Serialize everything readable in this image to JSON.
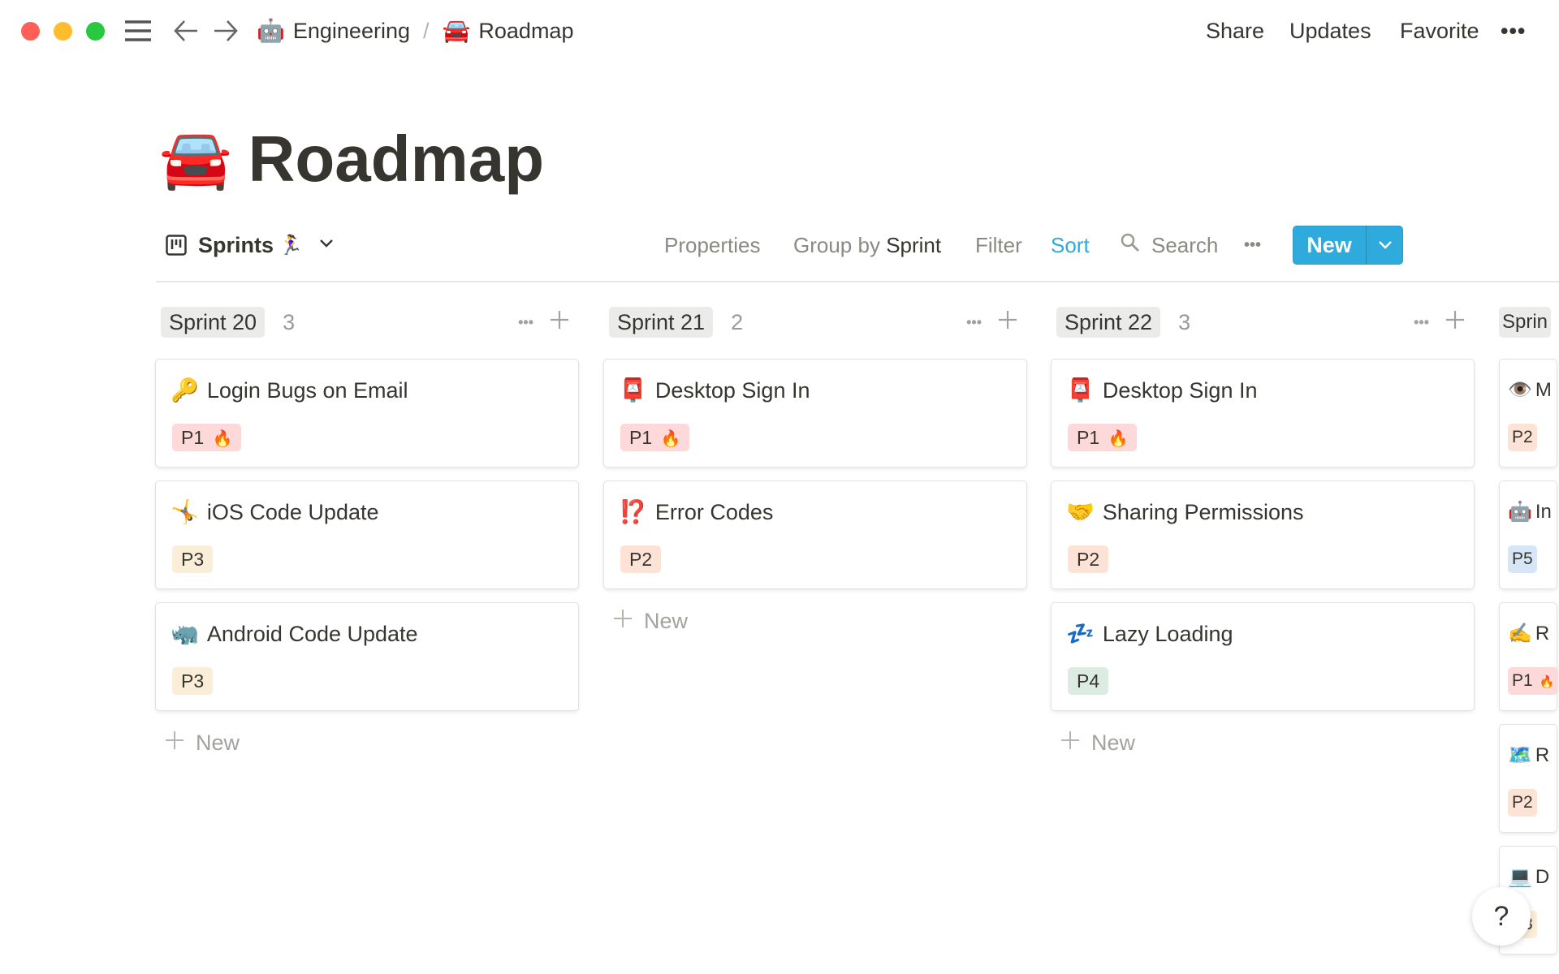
{
  "window": {
    "traffic_lights": {
      "close": "#ff5f57",
      "minimize": "#febc2e",
      "zoom": "#28c840"
    }
  },
  "topbar": {
    "breadcrumb": [
      {
        "icon": "🤖",
        "label": "Engineering"
      },
      {
        "icon": "🚘",
        "label": "Roadmap"
      }
    ],
    "separator": "/",
    "actions": {
      "share": "Share",
      "updates": "Updates",
      "favorite": "Favorite",
      "more": "•••"
    }
  },
  "page": {
    "icon": "🚘",
    "title": "Roadmap"
  },
  "toolbar": {
    "view_name": "Sprints",
    "view_emoji": "🏃‍♀️",
    "properties": "Properties",
    "group_by_prefix": "Group by",
    "group_by_value": "Sprint",
    "filter": "Filter",
    "sort": "Sort",
    "search": "Search",
    "more": "•••",
    "new_label": "New",
    "accent": "#2eaadc"
  },
  "priority_colors": {
    "P1": "#fdd9d9",
    "P2": "#fde2d6",
    "P3": "#fbeed8",
    "P4": "#dcece3",
    "P5": "#d7e6f6"
  },
  "board": {
    "add_new_label": "New",
    "columns": [
      {
        "name": "Sprint 20",
        "count": "3",
        "cards": [
          {
            "emoji": "🔑",
            "title": "Login Bugs on Email",
            "priority": "P1",
            "flag": "🔥"
          },
          {
            "emoji": "🤸",
            "title": "iOS Code Update",
            "priority": "P3",
            "flag": ""
          },
          {
            "emoji": "🦏",
            "title": "Android Code Update",
            "priority": "P3",
            "flag": ""
          }
        ]
      },
      {
        "name": "Sprint 21",
        "count": "2",
        "cards": [
          {
            "emoji": "📮",
            "title": "Desktop Sign In",
            "priority": "P1",
            "flag": "🔥"
          },
          {
            "emoji": "⁉️",
            "title": "Error Codes",
            "priority": "P2",
            "flag": ""
          }
        ]
      },
      {
        "name": "Sprint 22",
        "count": "3",
        "cards": [
          {
            "emoji": "📮",
            "title": "Desktop Sign In",
            "priority": "P1",
            "flag": "🔥"
          },
          {
            "emoji": "🤝",
            "title": "Sharing Permissions",
            "priority": "P2",
            "flag": ""
          },
          {
            "emoji": "💤",
            "title": "Lazy Loading",
            "priority": "P4",
            "flag": ""
          }
        ]
      },
      {
        "name": "Sprin",
        "count": "",
        "cards": [
          {
            "emoji": "👁️",
            "title": "M",
            "priority": "P2",
            "flag": ""
          },
          {
            "emoji": "🤖",
            "title": "In",
            "priority": "P5",
            "flag": ""
          },
          {
            "emoji": "✍️",
            "title": "R",
            "priority": "P1",
            "flag": "🔥"
          },
          {
            "emoji": "🗺️",
            "title": "R",
            "priority": "P2",
            "flag": ""
          },
          {
            "emoji": "💻",
            "title": "D",
            "priority": "P3",
            "flag": ""
          }
        ]
      }
    ]
  },
  "help": {
    "label": "?"
  }
}
